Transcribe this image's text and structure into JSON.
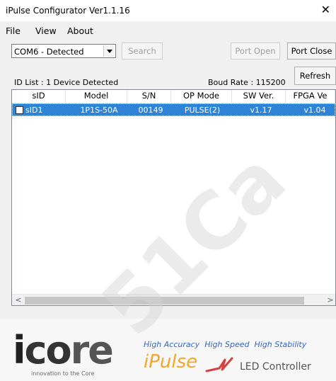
{
  "window": {
    "title": "iPulse Configurator Ver1.1.16",
    "close_glyph": "✕"
  },
  "menu": {
    "items": [
      "File",
      "View",
      "About"
    ]
  },
  "toolbar": {
    "port_select": "COM6 - Detected",
    "search": "Search",
    "port_open": "Port Open",
    "port_close": "Port Close",
    "refresh": "Refresh"
  },
  "status": {
    "id_list": "ID List : 1 Device Detected",
    "baud": "Boud Rate : 115200"
  },
  "table": {
    "columns": [
      "sID",
      "Model",
      "S/N",
      "OP Mode",
      "SW Ver.",
      "FPGA Ve"
    ],
    "rows": [
      [
        "sID1",
        "1P1S-50A",
        "00149",
        "PULSE(2)",
        "v1.17",
        "v1.04"
      ]
    ]
  },
  "scrollbar": {
    "left_arrow": "<",
    "right_arrow": ">"
  },
  "footer": {
    "logo_i": "i",
    "logo_co": "co",
    "logo_re": "re",
    "logo_sub": "innovation to the Core",
    "tag1": "High Accuracy",
    "tag2": "High Speed",
    "tag3": "High Stability",
    "brand": "iPulse",
    "product": "LED Controller"
  },
  "colors": {
    "selection": "#2e83d6",
    "tagline": "#3466c4",
    "brand": "#f2a72c"
  },
  "watermark": "51Ca"
}
